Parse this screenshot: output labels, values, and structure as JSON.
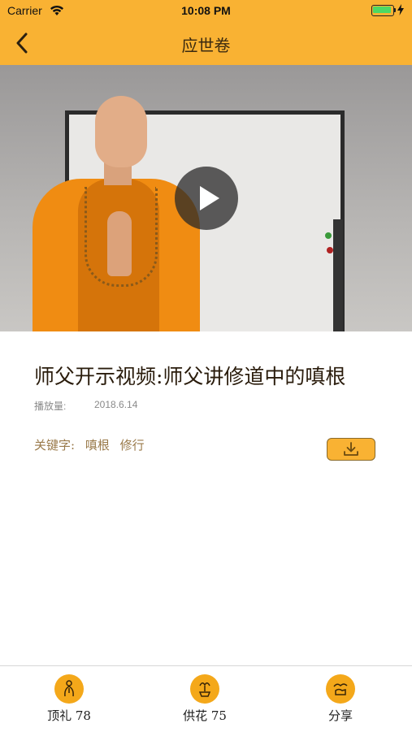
{
  "status_bar": {
    "carrier": "Carrier",
    "time": "10:08 PM",
    "battery_level": 1.0
  },
  "nav": {
    "title": "应世卷",
    "back_icon": "chevron-left-icon"
  },
  "video": {
    "play_icon": "play-icon"
  },
  "article": {
    "title": "师父开示视频:师父讲修道中的嗔根",
    "views_label": "播放量:",
    "date": "2018.6.14",
    "keywords_label": "关键字:",
    "keywords": [
      "嗔根",
      "修行"
    ],
    "download_icon": "download-icon"
  },
  "tabbar": {
    "items": [
      {
        "label": "顶礼 78",
        "icon": "bow-icon"
      },
      {
        "label": "供花 75",
        "icon": "flower-icon"
      },
      {
        "label": "分享",
        "icon": "share-icon"
      }
    ]
  },
  "colors": {
    "accent": "#F9B233",
    "icon_bg": "#F4A81A",
    "title_text": "#2a1c0c",
    "keyword_text": "#9a7a4a"
  }
}
